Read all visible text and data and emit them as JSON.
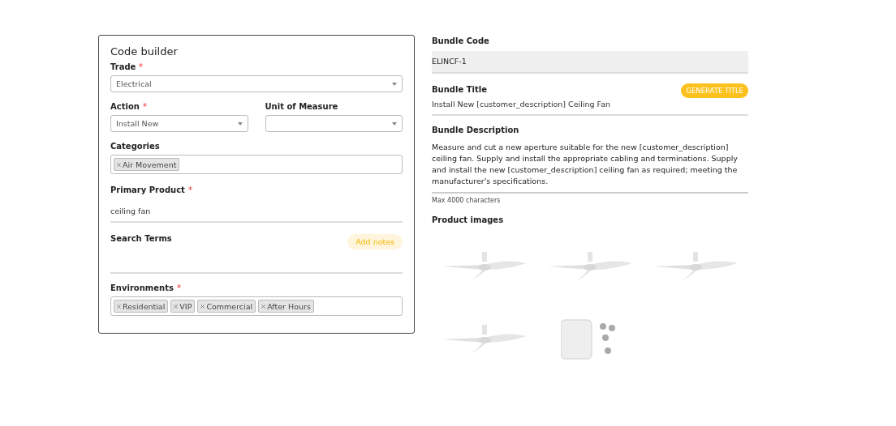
{
  "code_builder": {
    "title": "Code builder",
    "trade": {
      "label": "Trade",
      "required": true,
      "value": "Electrical"
    },
    "action": {
      "label": "Action",
      "required": true,
      "value": "Install New"
    },
    "unit_of_measure": {
      "label": "Unit of Measure",
      "required": false
    },
    "categories": {
      "label": "Categories",
      "required": false,
      "tags": [
        "Air Movement"
      ]
    },
    "primary_product": {
      "label": "Primary Product",
      "required": true,
      "value": "ceiling fan"
    },
    "search_terms": {
      "label": "Search Terms",
      "button": "Add notes"
    },
    "environments": {
      "label": "Environments",
      "required": true,
      "tags": [
        "Residential",
        "VIP",
        "Commercial",
        "After Hours"
      ]
    }
  },
  "bundle": {
    "code": {
      "label": "Bundle Code",
      "value": "ELINCF-1"
    },
    "title": {
      "label": "Bundle Title",
      "button": "GENERATE TITLE",
      "value": "Install New [customer_description] Ceiling Fan"
    },
    "description": {
      "label": "Bundle Description",
      "value": "Measure and cut a new aperture suitable for the new [customer_description] ceiling fan. Supply and install the appropriate cabling and terminations. Supply and install the new [customer_description] ceiling fan as required; meeting the manufacturer's specifications.",
      "hint": "Max 4000 characters"
    },
    "images": {
      "label": "Product images",
      "items": [
        {
          "kind": "fan"
        },
        {
          "kind": "fan"
        },
        {
          "kind": "fan"
        },
        {
          "kind": "fan"
        },
        {
          "kind": "box"
        }
      ]
    }
  }
}
